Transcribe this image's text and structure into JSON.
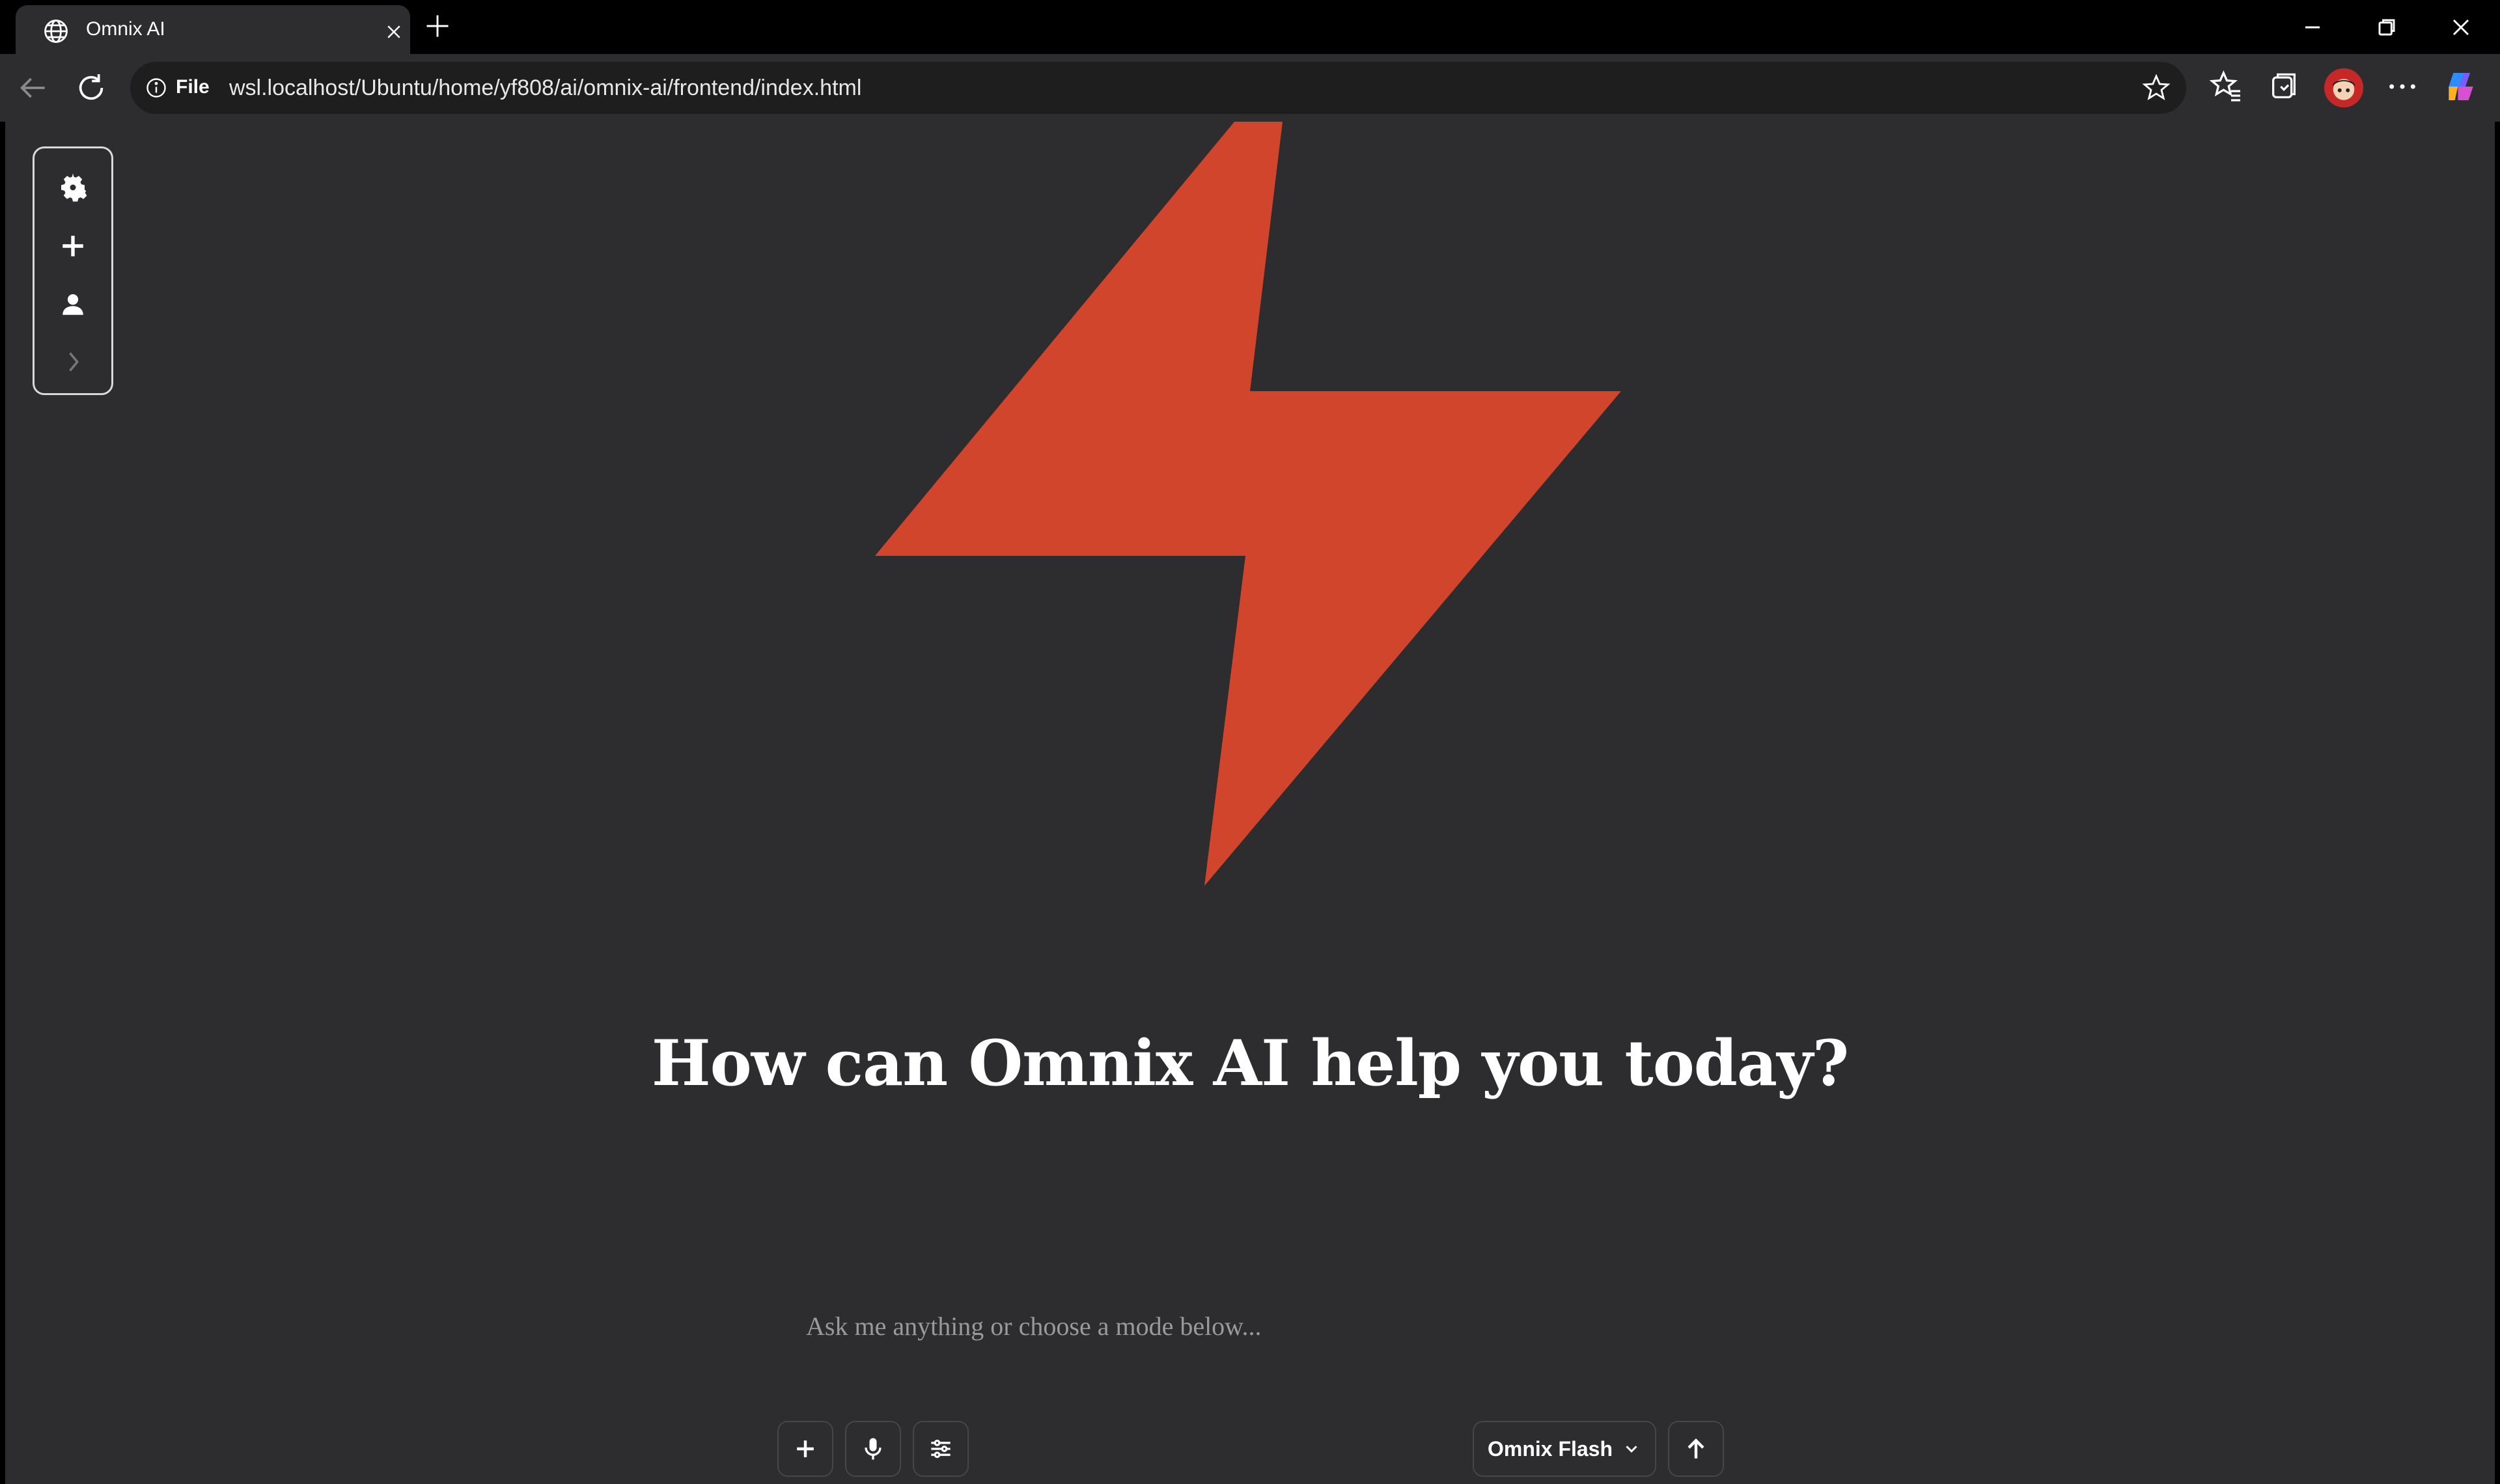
{
  "browser": {
    "tab_title": "Omnix AI",
    "address_prefix": "File",
    "url": "wsl.localhost/Ubuntu/home/yf808/ai/omnix-ai/frontend/index.html"
  },
  "sidebar": {
    "items": [
      {
        "icon": "gear-icon",
        "label": ""
      },
      {
        "icon": "plus-icon",
        "label": ""
      },
      {
        "icon": "user-icon",
        "label": ""
      },
      {
        "icon": "chevron-right-icon",
        "label": ""
      }
    ]
  },
  "hero": {
    "logo_icon": "lightning-bolt-icon",
    "logo_color": "#d0452b",
    "headline": "How can Omnix AI help you today?"
  },
  "composer": {
    "placeholder": "Ask me anything or choose a mode below...",
    "model_label": "Omnix Flash"
  }
}
